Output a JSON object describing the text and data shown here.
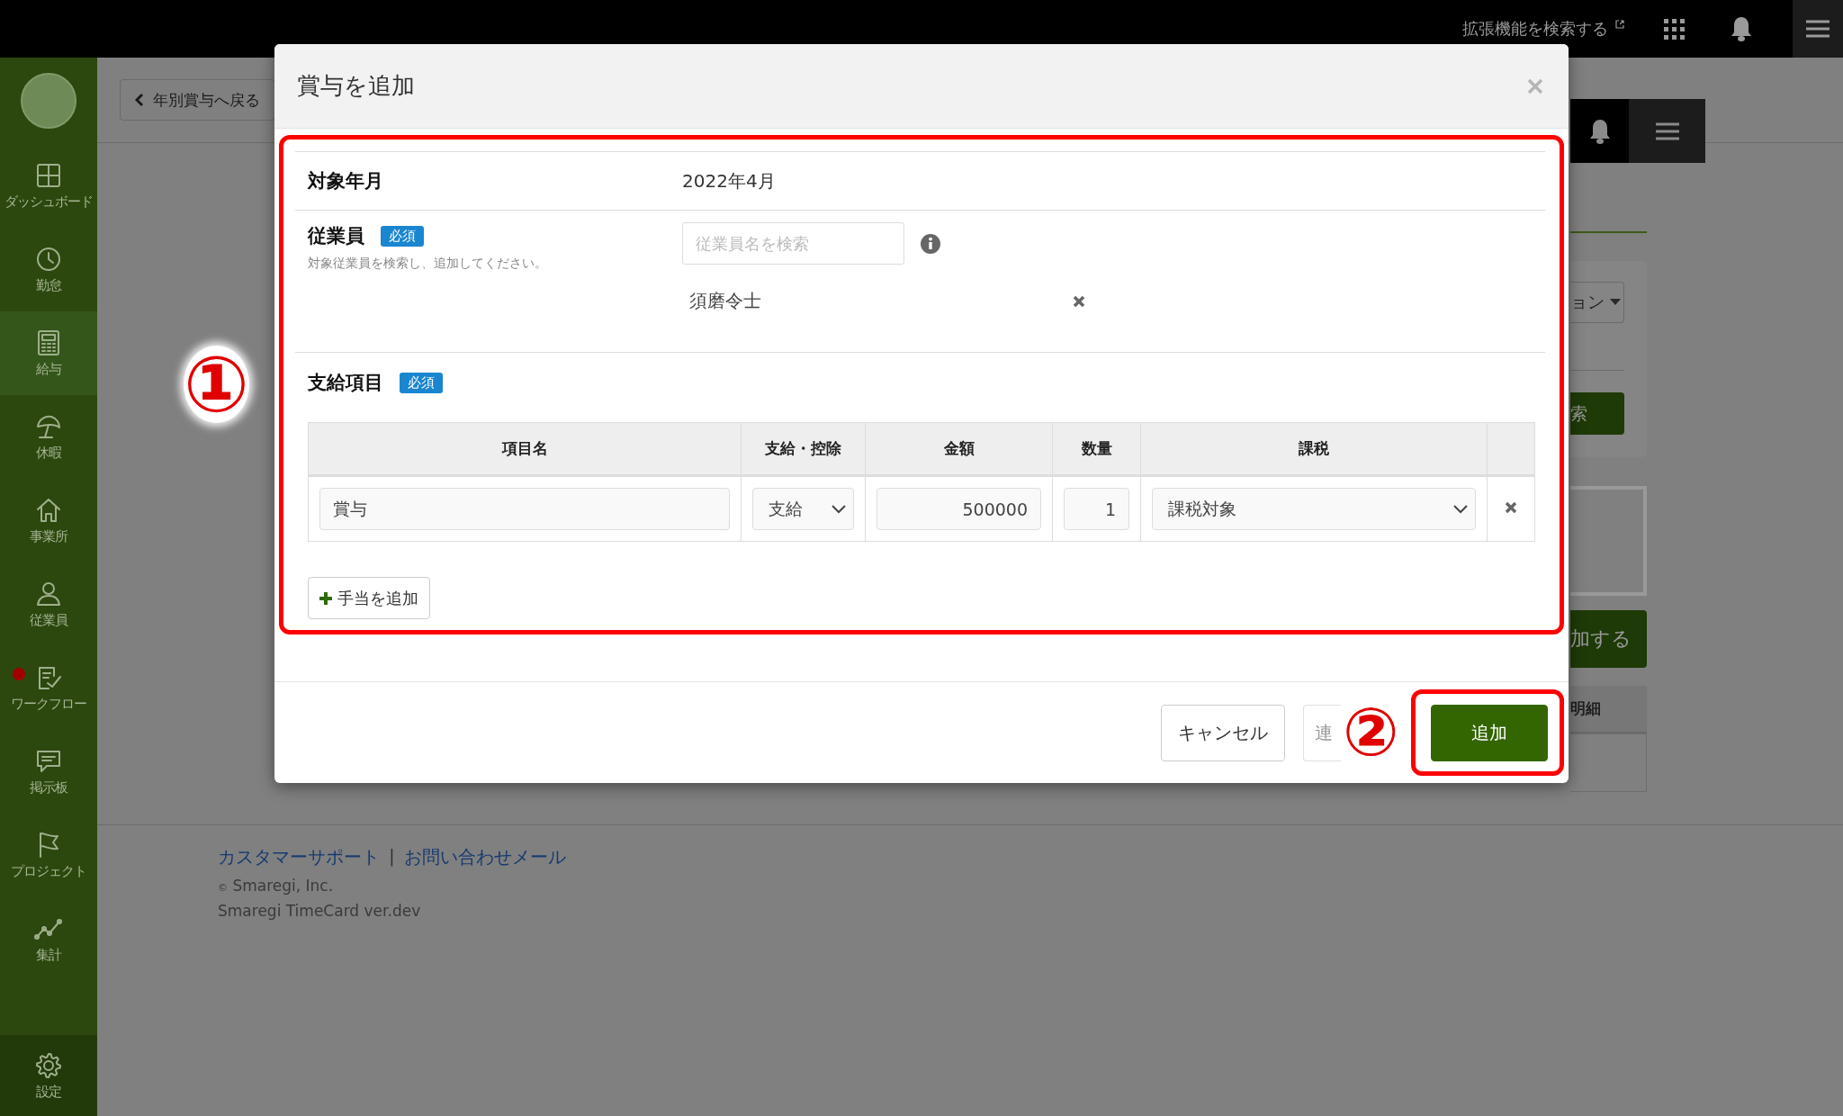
{
  "topbar": {
    "extension_search": "拡張機能を検索する"
  },
  "sidebar": {
    "items": [
      {
        "label": "ダッシュボード",
        "selected": false,
        "notification": false
      },
      {
        "label": "勤怠",
        "selected": false,
        "notification": false
      },
      {
        "label": "給与",
        "selected": true,
        "notification": false
      },
      {
        "label": "休暇",
        "selected": false,
        "notification": false
      },
      {
        "label": "事業所",
        "selected": false,
        "notification": false
      },
      {
        "label": "従業員",
        "selected": false,
        "notification": false
      },
      {
        "label": "ワークフロー",
        "selected": false,
        "notification": true
      },
      {
        "label": "掲示板",
        "selected": false,
        "notification": false
      },
      {
        "label": "プロジェクト",
        "selected": false,
        "notification": false
      },
      {
        "label": "集計",
        "selected": false,
        "notification": false
      }
    ],
    "settings": {
      "label": "設定"
    }
  },
  "page": {
    "back_button": "年別賞与へ戻る",
    "dropdown_fragment": "ョン",
    "search_fragment": "索",
    "add_fragment": "加する",
    "table_header_fragment": "明細"
  },
  "footer": {
    "links": [
      "カスタマーサポート",
      "お問い合わせメール"
    ],
    "separator": "|",
    "copyright_mark": "©",
    "copyright": "Smaregi, Inc.",
    "version": "Smaregi TimeCard ver.dev"
  },
  "modal": {
    "title": "賞与を追加",
    "target_month": {
      "label": "対象年月",
      "value": "2022年4月"
    },
    "employee": {
      "label": "従業員",
      "badge": "必須",
      "help": "対象従業員を検索し、追加してください。",
      "search": {
        "placeholder": "従業員名を検索"
      },
      "selected": [
        "須磨令士"
      ]
    },
    "pay_items": {
      "label": "支給項目",
      "badge": "必須",
      "columns": [
        "項目名",
        "支給・控除",
        "金額",
        "数量",
        "課税"
      ],
      "rows": [
        {
          "name": "賞与",
          "type": "支給",
          "amount": "500000",
          "quantity": "1",
          "tax": "課税対象"
        }
      ],
      "add_button": "手当を追加"
    },
    "buttons": [
      {
        "label": "キャンセル",
        "kind": "default",
        "disabled": false
      },
      {
        "label": "連",
        "kind": "default",
        "disabled": true
      },
      {
        "label": "追加",
        "kind": "primary",
        "disabled": false
      }
    ]
  },
  "annotations": [
    {
      "label": "①"
    },
    {
      "label": "②"
    }
  ]
}
